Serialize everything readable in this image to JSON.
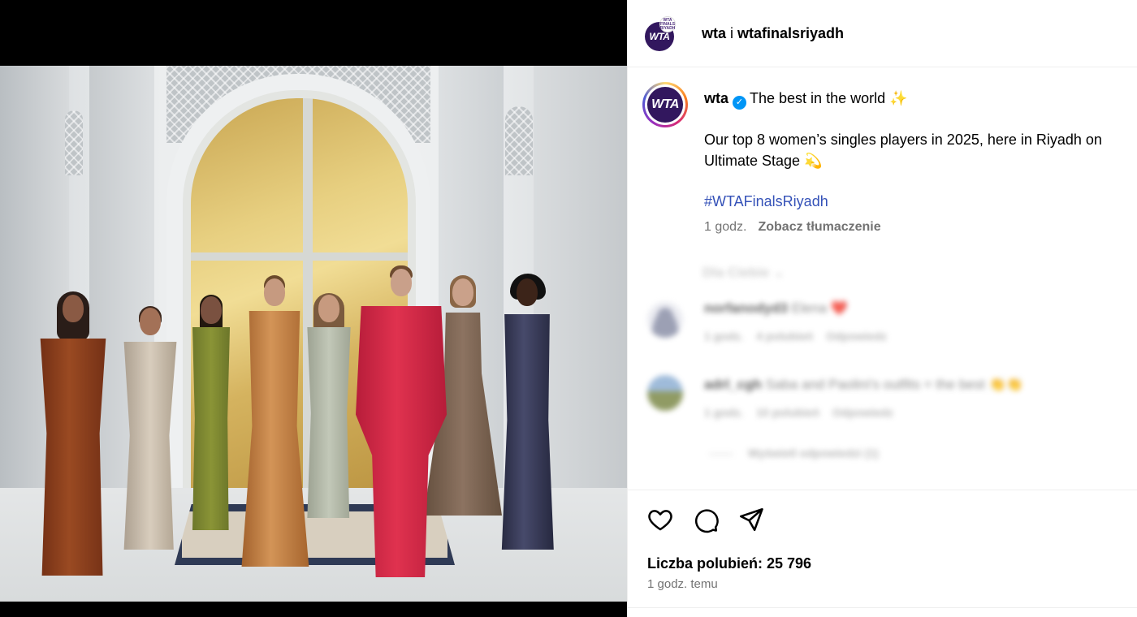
{
  "post_header": {
    "author": "wta",
    "separator": "i",
    "collaborator": "wtafinalsriyadh",
    "avatar_logo": "WTA",
    "collab_avatar_text": "WTA FINALS RIYADH"
  },
  "caption": {
    "username": "wta",
    "verified_icon": "verified-badge-icon",
    "headline": "The best in the world",
    "headline_emoji": "✨",
    "body": "Our top 8 women’s singles players in 2025, here in Riyadh on",
    "body_line2": "Ultimate Stage",
    "body_emoji": "💫",
    "hashtag": "#WTAFinalsRiyadh",
    "time": "1 godz.",
    "translate_link": "Zobacz tłumaczenie"
  },
  "comments_blurred": {
    "section_label": "Dla Ciebie",
    "items": [
      {
        "username": "norfanodyd3",
        "text": "Elena",
        "emoji": "❤️",
        "time": "1 godz.",
        "likes": "4 polubień",
        "reply": "Odpowiedz"
      },
      {
        "username": "adrl_cgh",
        "text": "Saba and Paolini's outfits = the best",
        "emoji": "👏👏",
        "time": "1 godz.",
        "likes": "10 polubień",
        "reply": "Odpowiedz"
      }
    ],
    "view_replies": "Wyświetl odpowiedzi (1)"
  },
  "actions": {
    "like_icon": "heart-icon",
    "comment_icon": "comment-icon",
    "share_icon": "paper-plane-icon"
  },
  "stats": {
    "likes_text": "Liczba polubień: 25 796",
    "time_ago": "1 godz. temu"
  },
  "colors": {
    "hashtag": "#3552b8",
    "verified": "#0095f6",
    "muted": "#737373",
    "wta_purple": "#32175e"
  }
}
